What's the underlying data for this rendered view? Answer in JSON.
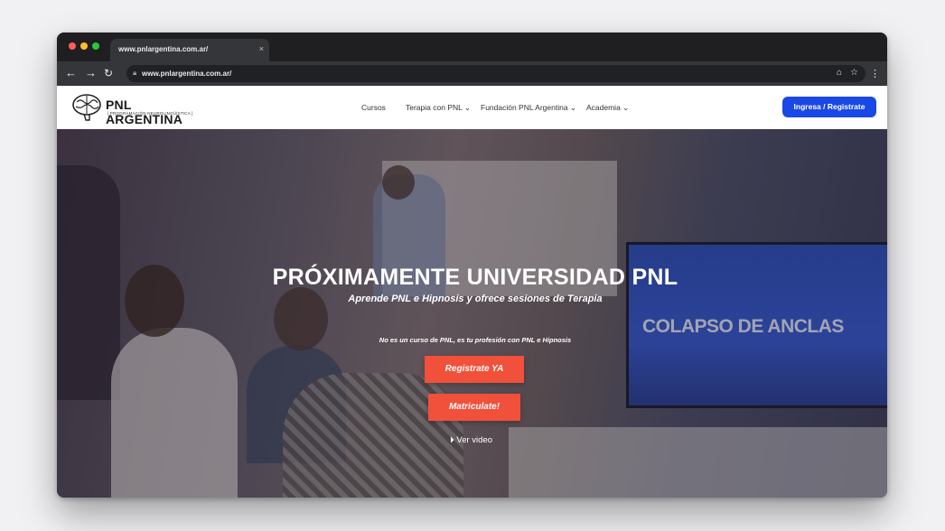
{
  "browser": {
    "tab_title": "www.pnlargentina.com.ar/",
    "tab_close": "×",
    "url": "www.pnlargentina.com.ar/",
    "icons": [
      "back-arrow-icon",
      "forward-arrow-icon",
      "reload-icon",
      "lock-icon",
      "cast-icon",
      "star-icon",
      "menu-dots-icon"
    ]
  },
  "site": {
    "logo_name": "PNL ARGENTINA",
    "logo_tagline": "[ PROGRAMACIÓN NEUROLINGÜÍSTICA ]",
    "nav": [
      {
        "label": "Cursos"
      },
      {
        "label": "Terapia con PNL ⌄"
      },
      {
        "label": "Fundación PNL Argentina ⌄"
      },
      {
        "label": "Academia ⌄"
      }
    ],
    "cta_label": "Ingresa / Registrate",
    "accent": "#1a48e6"
  },
  "hero": {
    "title": "PRÓXIMAMENTE UNIVERSIDAD PNL",
    "subtitle": "Aprende PNL e Hipnosis y ofrece sesiones de Terapia",
    "note": "No es un curso de PNL, es tu profesión con PNL e Hipnosis",
    "button_register": "Registrate YA",
    "button_enroll": "Matriculate!",
    "video_link": "Ver video",
    "screen_text": "COLAPSO DE ANCLAS",
    "button_color": "#f1503a"
  }
}
